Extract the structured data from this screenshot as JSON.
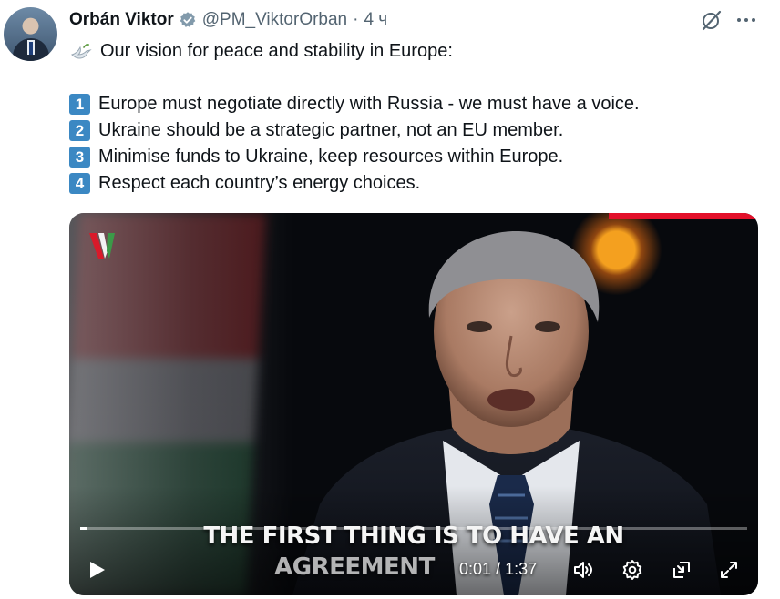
{
  "author": {
    "name": "Orbán Viktor",
    "handle": "@PM_ViktorOrban",
    "separator": "·",
    "time": "4 ч"
  },
  "tweet": {
    "intro_emoji": "dove-icon",
    "intro": "Our vision for peace and stability in Europe:",
    "points": [
      {
        "number": "1",
        "text": "Europe must negotiate directly with Russia - we must have a voice."
      },
      {
        "number": "2",
        "text": "Ukraine should be a strategic partner, not an EU member."
      },
      {
        "number": "3",
        "text": "Minimise funds to Ukraine, keep resources within Europe."
      },
      {
        "number": "4",
        "text": "Respect each country’s energy choices."
      }
    ]
  },
  "video": {
    "caption_line1": "THE FIRST THING IS TO HAVE AN",
    "caption_line2": "AGREEMENT",
    "current_time": "0:01",
    "time_separator": " / ",
    "duration": "1:37",
    "progress_fraction": 0.01
  },
  "colors": {
    "text": "#0f1419",
    "secondary": "#536471",
    "verified_badge": "#829aab",
    "keycap": "#3b88c3",
    "video_accent": "#e2102a"
  }
}
